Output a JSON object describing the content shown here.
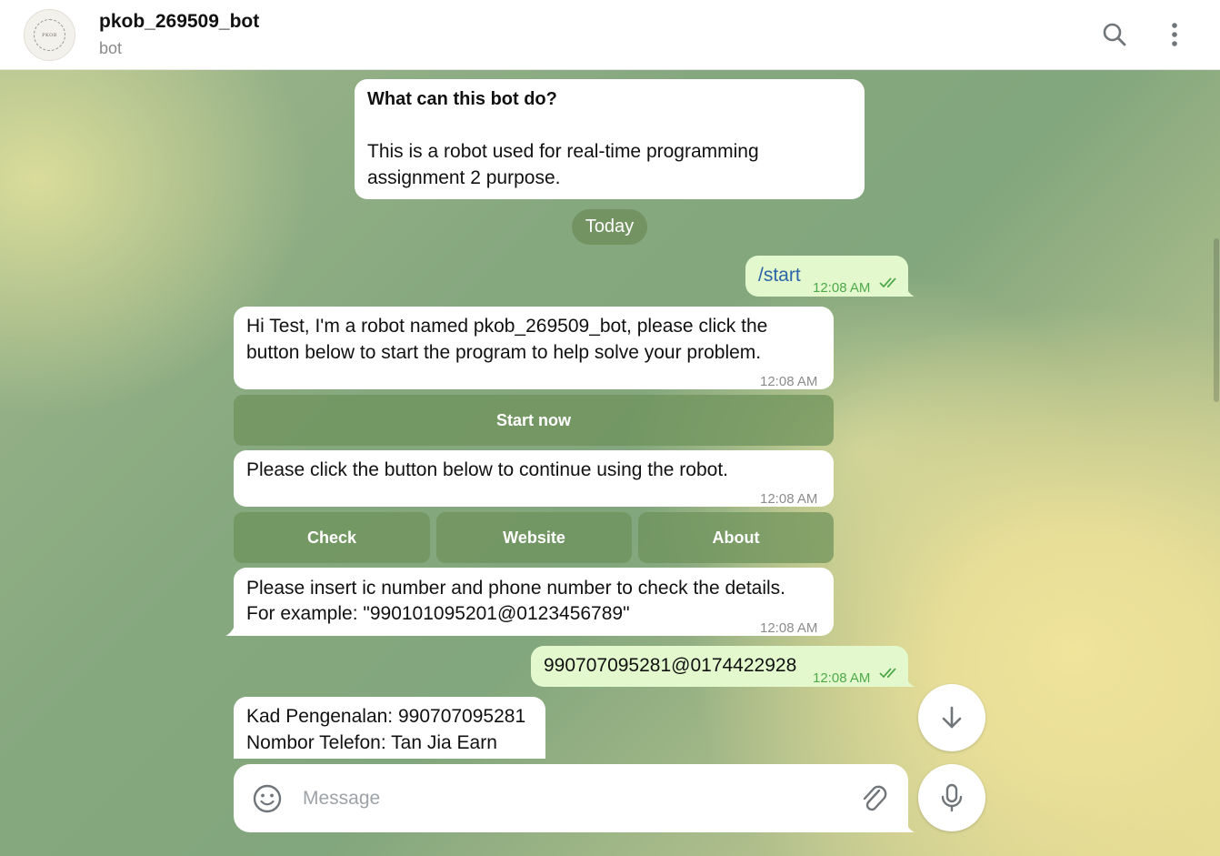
{
  "header": {
    "avatar_text": "PKOB",
    "title": "pkob_269509_bot",
    "subtitle": "bot",
    "search_icon": "search-icon",
    "menu_icon": "more-vertical-icon"
  },
  "messages": {
    "info": {
      "title": "What can this bot do?",
      "line1": "This is a robot used for real-time programming",
      "line2": "assignment 2 purpose."
    },
    "date_divider": "Today",
    "start_cmd": {
      "text": "/start",
      "time": "12:08 AM"
    },
    "greeting": {
      "line1": "Hi Test, I'm a robot named pkob_269509_bot, please click the",
      "line2": "button below to start the program to help solve your problem.",
      "time": "12:08 AM"
    },
    "start_button": "Start now",
    "continue_msg": {
      "text": "Please click the button below to continue using the robot.",
      "time": "12:08 AM"
    },
    "menu_buttons": [
      "Check",
      "Website",
      "About"
    ],
    "insert_msg": {
      "line1": "Please insert ic number and phone number to check the details.",
      "line2": "For example: \"990101095201@0123456789\"",
      "time": "12:08 AM"
    },
    "user_input": {
      "text": "990707095281@0174422928",
      "time": "12:08 AM"
    },
    "result_msg": {
      "line1": "Kad Pengenalan: 990707095281",
      "line2": "Nombor Telefon: Tan Jia Earn"
    }
  },
  "composer": {
    "placeholder": "Message",
    "emoji_icon": "emoji-icon",
    "attach_icon": "paperclip-icon",
    "mic_icon": "microphone-icon",
    "scroll_down_icon": "arrow-down-icon"
  },
  "colors": {
    "outgoing_bubble": "#e3f9cd",
    "incoming_bubble": "#ffffff",
    "time_outgoing": "#4fa94a",
    "keyboard_button": "#6e915a"
  }
}
